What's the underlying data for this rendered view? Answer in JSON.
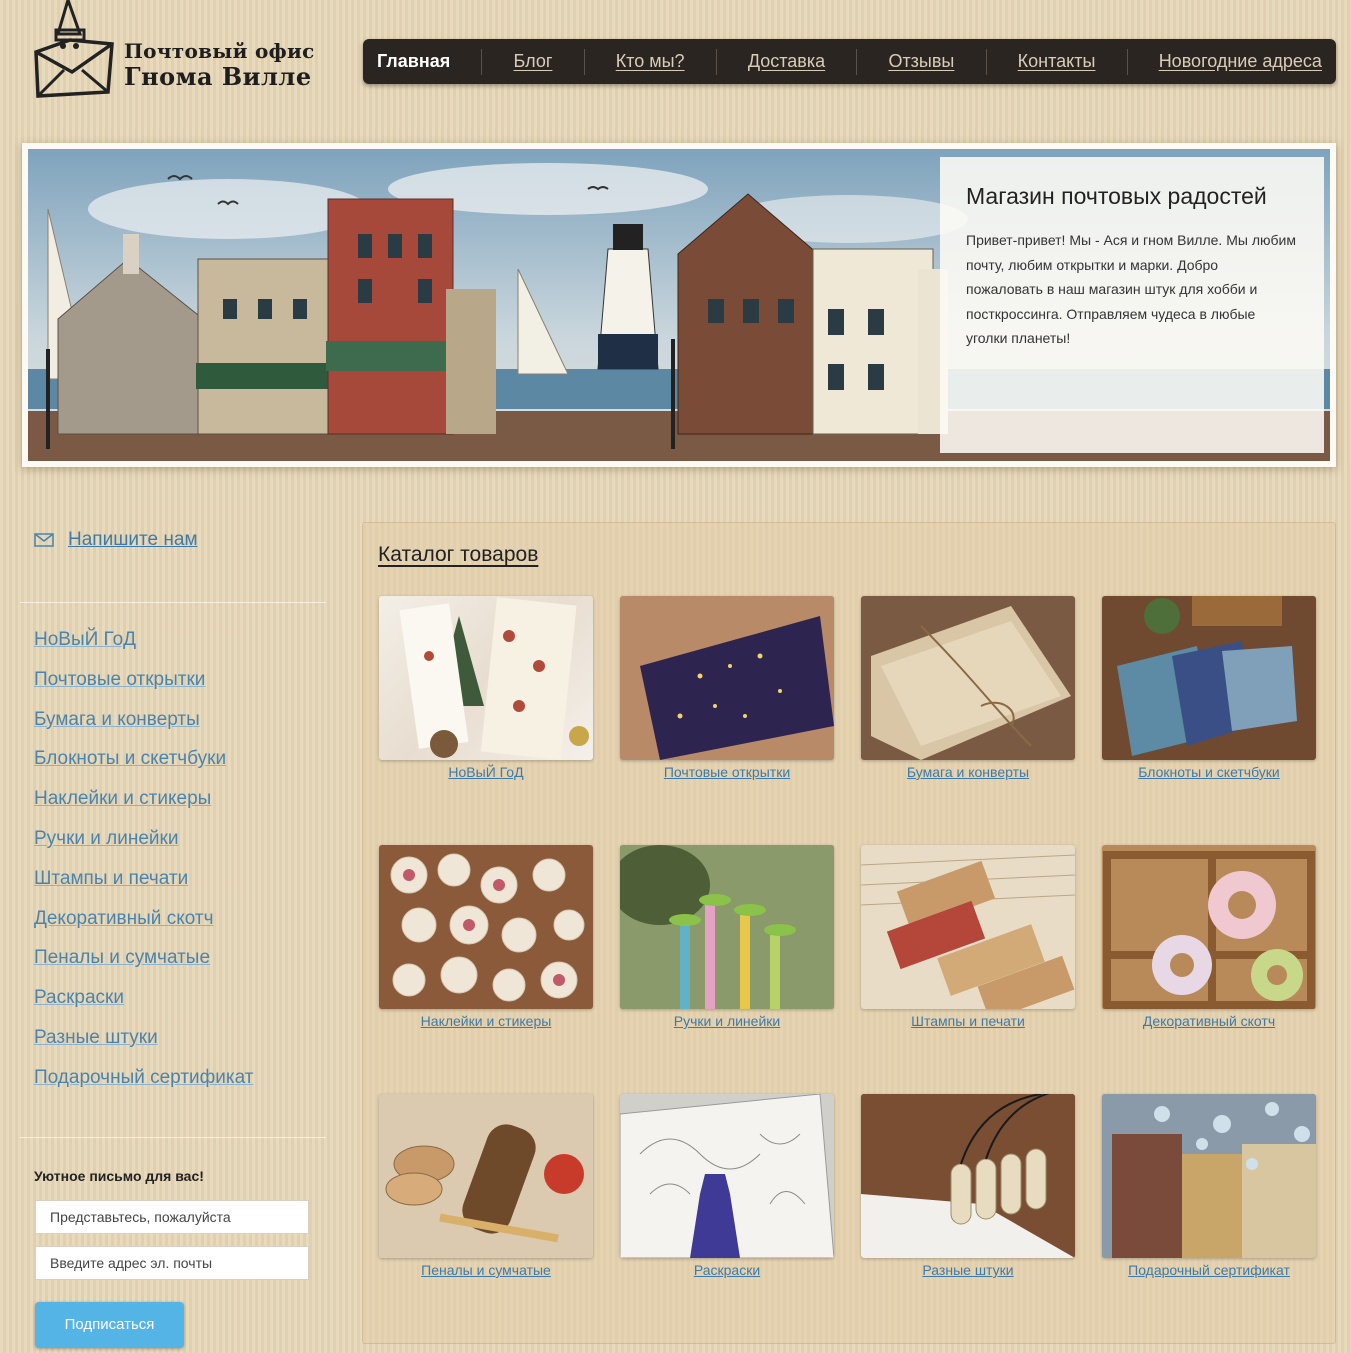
{
  "header": {
    "logo_line1": "Почтовый офис",
    "logo_line2": "Гнома Вилле",
    "nav": [
      {
        "label": "Главная",
        "active": true
      },
      {
        "label": "Блог"
      },
      {
        "label": "Кто мы?"
      },
      {
        "label": "Доставка"
      },
      {
        "label": "Отзывы"
      },
      {
        "label": "Контакты"
      },
      {
        "label": "Новогодние адреса"
      }
    ]
  },
  "banner": {
    "title": "Магазин почтовых радостей",
    "text": "Привет-привет! Мы - Ася и гном Вилле. Мы любим почту, любим открытки и марки. Добро пожаловать в наш магазин штук для хобби и посткроссинга. Отправляем чудеса в любые уголки планеты!"
  },
  "sidebar": {
    "write_us": "Напишите нам",
    "categories": [
      "НоВыЙ ГоД",
      "Почтовые открытки",
      "Бумага и конверты",
      "Блокноты и скетчбуки",
      "Наклейки и стикеры",
      "Ручки и линейки",
      "Штампы и печати",
      "Декоративный скотч",
      "Пеналы и сумчатые",
      "Раскраски",
      "Разные штуки",
      "Подарочный сертификат"
    ],
    "subscribe": {
      "title": "Уютное письмо для вас!",
      "name_placeholder": "Представьтесь, пожалуйста",
      "email_placeholder": "Введите адрес эл. почты",
      "button": "Подписаться"
    }
  },
  "catalog": {
    "title": "Каталог товаров",
    "items": [
      "НоВыЙ ГоД",
      "Почтовые открытки",
      "Бумага и конверты",
      "Блокноты и скетчбуки",
      "Наклейки и стикеры",
      "Ручки и линейки",
      "Штампы и печати",
      "Декоративный скотч",
      "Пеналы и сумчатые",
      "Раскраски",
      "Разные штуки",
      "Подарочный сертификат"
    ]
  },
  "colors": {
    "nav_bg": "#2b2522",
    "link": "#4a84ad",
    "button": "#55b4e6",
    "page_bg": "#e6d6b6"
  }
}
